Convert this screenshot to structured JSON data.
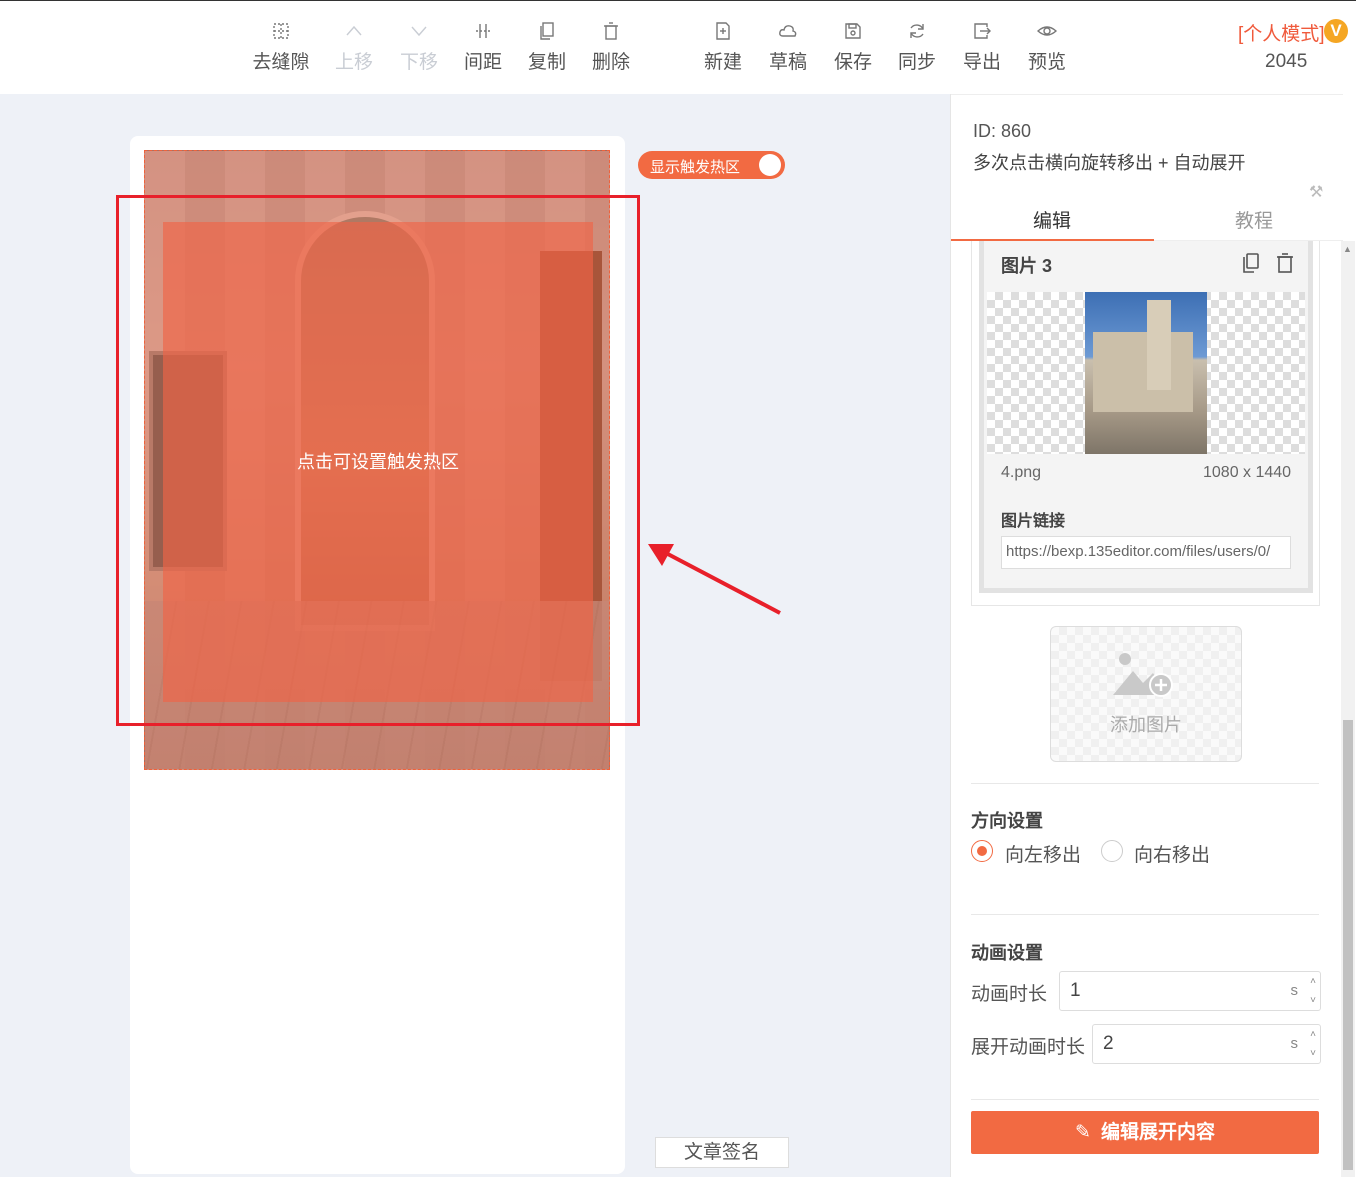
{
  "toolbar": {
    "items": [
      {
        "label": "去缝隙",
        "icon": "dashed-grid-icon"
      },
      {
        "label": "上移",
        "icon": "chevron-up-icon"
      },
      {
        "label": "下移",
        "icon": "chevron-down-icon"
      },
      {
        "label": "间距",
        "icon": "spacing-grid-icon"
      },
      {
        "label": "复制",
        "icon": "copy-icon"
      },
      {
        "label": "删除",
        "icon": "trash-icon"
      },
      {
        "label": "新建",
        "icon": "new-file-icon"
      },
      {
        "label": "草稿",
        "icon": "cloud-icon"
      },
      {
        "label": "保存",
        "icon": "save-icon"
      },
      {
        "label": "同步",
        "icon": "sync-icon"
      },
      {
        "label": "导出",
        "icon": "export-icon"
      },
      {
        "label": "预览",
        "icon": "eye-icon"
      }
    ],
    "mode_label": "[个人模式]",
    "vip_badge": "V",
    "mode_number": "2045"
  },
  "canvas": {
    "hotzone_toggle_label": "显示触发热区",
    "hotzone_toggle_on": true,
    "hotzone_hint": "点击可设置触发热区",
    "signature_button": "文章签名"
  },
  "panel": {
    "id_text": "ID: 860",
    "description": "多次点击横向旋转移出 + 自动展开",
    "tabs": [
      {
        "label": "编辑",
        "active": true
      },
      {
        "label": "教程",
        "active": false
      }
    ],
    "image_card": {
      "title": "图片 3",
      "file_name": "4.png",
      "dimensions": "1080 x 1440",
      "link_label": "图片链接",
      "link_value": "https://bexp.135editor.com/files/users/0/"
    },
    "add_image_label": "添加图片",
    "direction": {
      "title": "方向设置",
      "options": [
        {
          "label": "向左移出",
          "selected": true
        },
        {
          "label": "向右移出",
          "selected": false
        }
      ]
    },
    "animation": {
      "title": "动画设置",
      "duration_label": "动画时长",
      "duration_value": "1",
      "expand_label": "展开动画时长",
      "expand_value": "2",
      "unit": "s"
    },
    "edit_button": "编辑展开内容"
  },
  "colors": {
    "accent": "#f26a42",
    "highlight_frame": "#e8202a",
    "vip": "#f5a623"
  }
}
